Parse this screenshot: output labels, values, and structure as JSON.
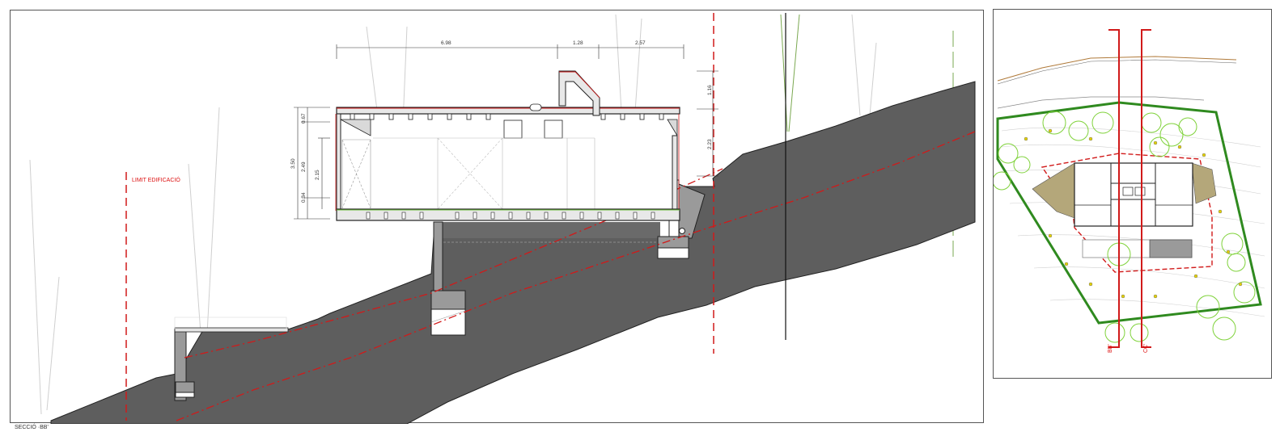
{
  "section": {
    "limit_label": "LIMIT EDIFICACIÓ",
    "caption": "SECCIÓ ·BB'",
    "dims_top": [
      "6.98",
      "1.28",
      "2.57"
    ],
    "dims_left": [
      "0.67",
      "3.50",
      "2.49",
      "2.15",
      "0.34"
    ],
    "dims_right": [
      "1.16",
      "2.23"
    ]
  },
  "site_plan": {
    "section_marks": [
      "BB'",
      "CC'"
    ]
  },
  "colors": {
    "ground": "#5e5e5e",
    "limit_line": "#d11a1a",
    "property_line": "#2f8a1f",
    "tree_canopy": "#7fd23a",
    "terrace": "#b4a77a"
  }
}
